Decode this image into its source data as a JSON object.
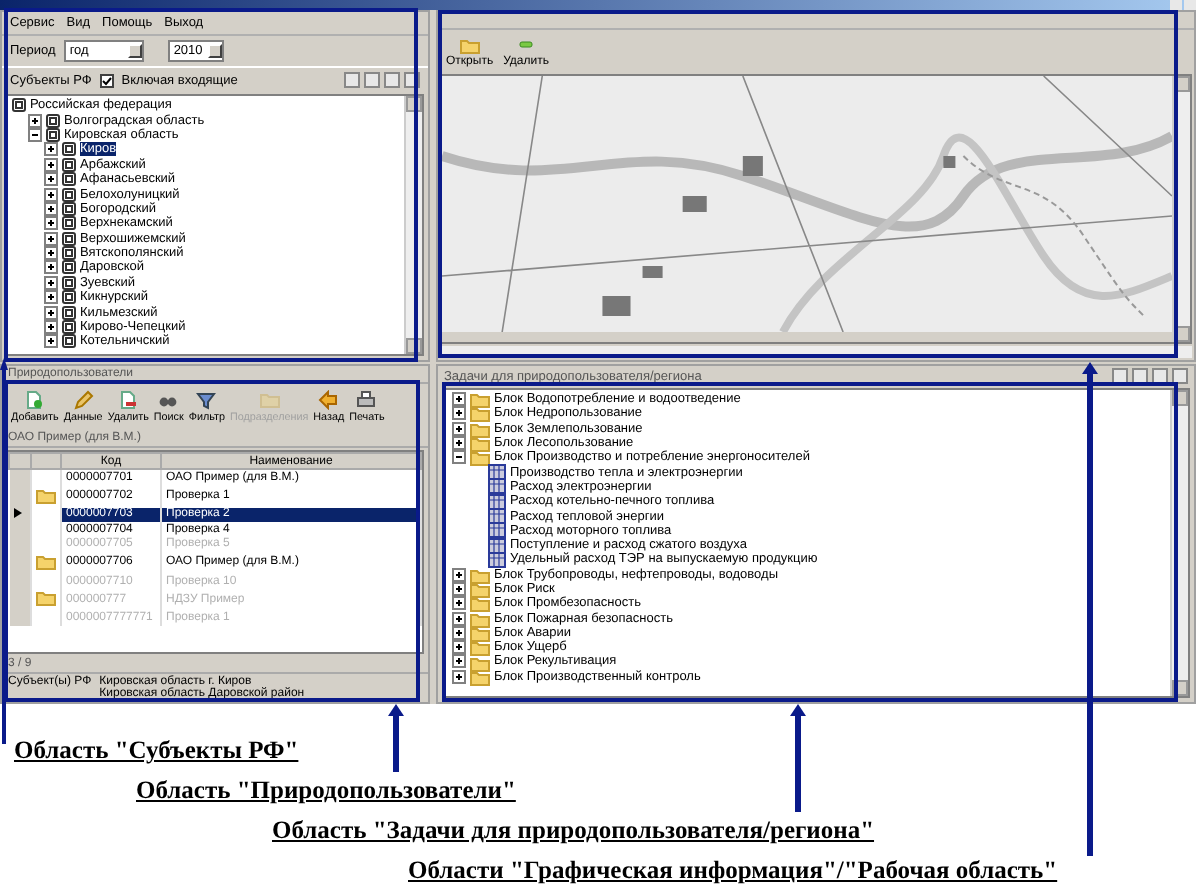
{
  "menu": [
    "Сервис",
    "Вид",
    "Помощь",
    "Выход"
  ],
  "period": {
    "label": "Период",
    "value": "год",
    "year": "2010"
  },
  "subjects": {
    "label": "Субъекты РФ",
    "include_children": {
      "label": "Включая входящие",
      "checked": true
    },
    "tree": [
      {
        "label": "Российская федерация",
        "children": [
          {
            "label": "Волгоградская область",
            "expanded": false,
            "selected": false
          },
          {
            "label": "Кировская область",
            "expanded": true,
            "selected": false,
            "children": [
              {
                "label": "Киров",
                "expanded": false,
                "selected": true
              },
              {
                "label": "Арбажский",
                "expanded": false,
                "selected": false
              },
              {
                "label": "Афанасьевский",
                "expanded": false,
                "selected": false
              },
              {
                "label": "Белохолуницкий",
                "expanded": false,
                "selected": false
              },
              {
                "label": "Богородский",
                "expanded": false,
                "selected": false
              },
              {
                "label": "Верхнекамский",
                "expanded": false,
                "selected": false
              },
              {
                "label": "Верхошижемский",
                "expanded": false,
                "selected": false
              },
              {
                "label": "Вятскополянский",
                "expanded": false,
                "selected": false
              },
              {
                "label": "Даровской",
                "expanded": false,
                "selected": false
              },
              {
                "label": "Зуевский",
                "expanded": false,
                "selected": false
              },
              {
                "label": "Кикнурский",
                "expanded": false,
                "selected": false
              },
              {
                "label": "Кильмезский",
                "expanded": false,
                "selected": false
              },
              {
                "label": "Кирово-Чепецкий",
                "expanded": false,
                "selected": false
              },
              {
                "label": "Котельничский",
                "expanded": false,
                "selected": false
              }
            ]
          }
        ]
      }
    ]
  },
  "map": {
    "toolbar": [
      "Открыть",
      "Удалить"
    ]
  },
  "users": {
    "title": "Природопользователи",
    "toolbar": [
      {
        "label": "Добавить",
        "disabled": false
      },
      {
        "label": "Данные",
        "disabled": false
      },
      {
        "label": "Удалить",
        "disabled": false
      },
      {
        "label": "Поиск",
        "disabled": false
      },
      {
        "label": "Фильтр",
        "disabled": false
      },
      {
        "label": "Подразделения",
        "disabled": true
      },
      {
        "label": "Назад",
        "disabled": false
      },
      {
        "label": "Печать",
        "disabled": false
      }
    ],
    "path": "ОАО Пример (для В.М.)",
    "columns": [
      "Код",
      "Наименование"
    ],
    "rows": [
      {
        "code": "0000007701",
        "name": "ОАО Пример (для В.М.)",
        "folder": false,
        "disabled": false,
        "selected": false
      },
      {
        "code": "0000007702",
        "name": "Проверка 1",
        "folder": true,
        "disabled": false,
        "selected": false
      },
      {
        "code": "0000007703",
        "name": "Проверка 2",
        "folder": false,
        "disabled": false,
        "selected": true
      },
      {
        "code": "0000007704",
        "name": "Проверка 4",
        "folder": false,
        "disabled": false,
        "selected": false
      },
      {
        "code": "0000007705",
        "name": "Проверка 5",
        "folder": false,
        "disabled": true,
        "selected": false
      },
      {
        "code": "0000007706",
        "name": "ОАО Пример (для В.М.)",
        "folder": true,
        "disabled": false,
        "selected": false
      },
      {
        "code": "0000007710",
        "name": "Проверка 10",
        "folder": false,
        "disabled": true,
        "selected": false
      },
      {
        "code": "000000777",
        "name": "НДЗУ Пример",
        "folder": true,
        "disabled": true,
        "selected": false
      },
      {
        "code": "0000007777771",
        "name": "Проверка 1",
        "folder": false,
        "disabled": true,
        "selected": false
      }
    ],
    "status": "3 / 9",
    "subjects_label": "Субъект(ы) РФ",
    "subjects": [
      "Кировская область г. Киров",
      "Кировская область Даровской район"
    ]
  },
  "tasks": {
    "title": "Задачи для природопользователя/региона",
    "tree": [
      {
        "label": "Блок Водопотребление и водоотведение",
        "kind": "block",
        "expanded": false
      },
      {
        "label": "Блок Недропользование",
        "kind": "block",
        "expanded": false
      },
      {
        "label": "Блок Землепользование",
        "kind": "block",
        "expanded": false
      },
      {
        "label": "Блок Лесопользование",
        "kind": "block",
        "expanded": false
      },
      {
        "label": "Блок Производство и потребление энергоносителей",
        "kind": "block",
        "expanded": true,
        "children": [
          {
            "label": "Производство тепла и электроэнергии",
            "kind": "table"
          },
          {
            "label": "Расход электроэнергии",
            "kind": "table"
          },
          {
            "label": "Расход котельно-печного топлива",
            "kind": "table"
          },
          {
            "label": "Расход  тепловой  энергии",
            "kind": "table"
          },
          {
            "label": "Расход  моторного топлива",
            "kind": "table"
          },
          {
            "label": "Поступление и расход сжатого воздуха",
            "kind": "table"
          },
          {
            "label": "Удельный расход ТЭР на выпускаемую продукцию",
            "kind": "table"
          }
        ]
      },
      {
        "label": "Блок Трубопроводы, нефтепроводы, водоводы",
        "kind": "block",
        "expanded": false
      },
      {
        "label": "Блок Риск",
        "kind": "block",
        "expanded": false
      },
      {
        "label": "Блок Промбезопасность",
        "kind": "block",
        "expanded": false
      },
      {
        "label": "Блок Пожарная безопасность",
        "kind": "block",
        "expanded": false
      },
      {
        "label": "Блок Аварии",
        "kind": "block",
        "expanded": false
      },
      {
        "label": "Блок Ущерб",
        "kind": "block",
        "expanded": false
      },
      {
        "label": "Блок Рекультивация",
        "kind": "block",
        "expanded": false
      },
      {
        "label": "Блок Производственный контроль",
        "kind": "block",
        "expanded": false
      }
    ]
  },
  "annotations": [
    "Область \"Субъекты РФ\"",
    "Область \"Природопользователи\"",
    "Область \"Задачи для природопользователя/региона\"",
    "Области \"Графическая информация\"/\"Рабочая область\""
  ]
}
